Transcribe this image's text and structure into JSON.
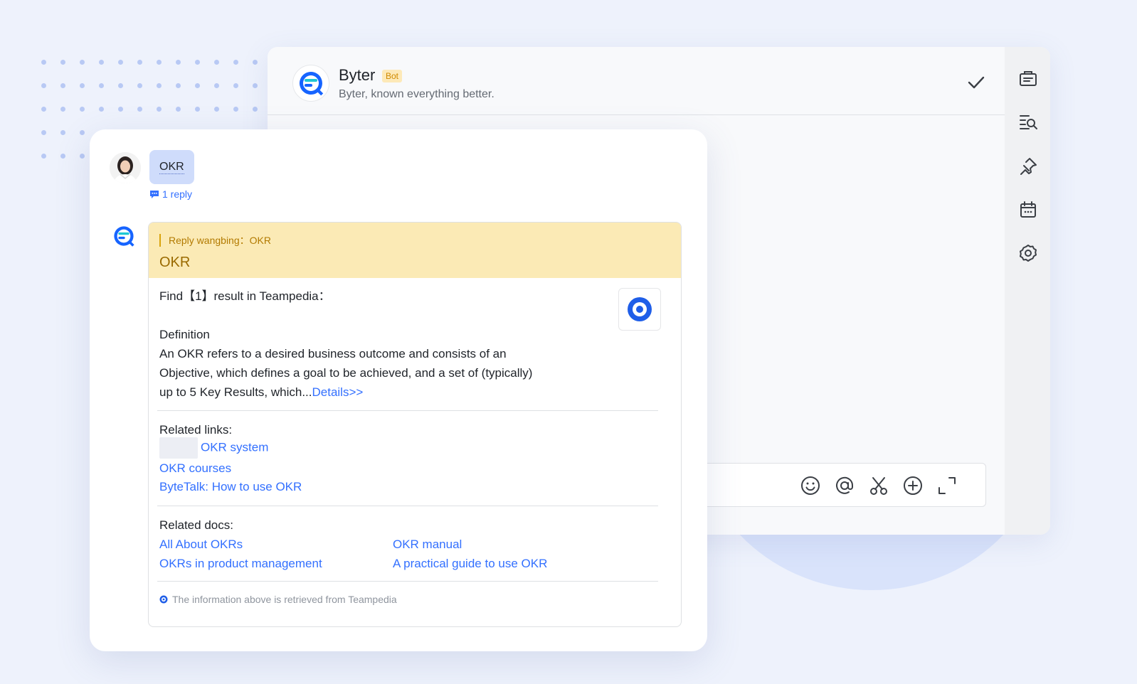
{
  "chat": {
    "bot_name": "Byter",
    "bot_tag": "Bot",
    "bot_desc": "Byter, known everything better.",
    "rail_icons": [
      "announcement-icon",
      "search-list-icon",
      "pin-icon",
      "calendar-icon",
      "settings-icon"
    ],
    "input_tools": [
      "emoji-icon",
      "mention-icon",
      "scissors-icon",
      "add-icon",
      "expand-icon"
    ]
  },
  "message": {
    "user_text": "OKR",
    "reply_count": "1 reply"
  },
  "answer": {
    "quote": "Reply wangbing：OKR",
    "title": "OKR",
    "find_line": "Find【1】result in Teampedia：",
    "definition_label": "Definition",
    "definition_line1": "An OKR refers to a desired business outcome and consists of an",
    "definition_line2": "Objective, which defines a goal to be achieved, and a set of (typically)",
    "definition_line3": "up to 5 Key Results, which...",
    "details_link": "Details>>",
    "related_links_label": "Related links:",
    "related_links": [
      "OKR system",
      "OKR courses",
      "ByteTalk: How to use OKR"
    ],
    "related_docs_label": "Related docs:",
    "related_docs": [
      "All About OKRs",
      "OKR manual",
      "OKRs in product management",
      "A practical guide to use OKR"
    ],
    "footer": "The information above is retrieved from Teampedia"
  },
  "colors": {
    "accent": "#3370ff",
    "quote_bg": "#fbeab5",
    "user_bubble": "#cfdcfb"
  }
}
